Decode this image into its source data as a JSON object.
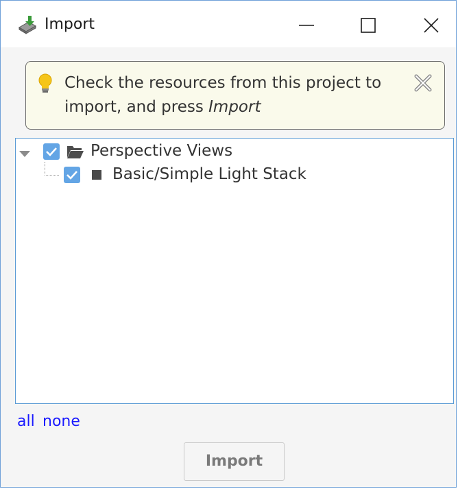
{
  "window": {
    "title": "Import",
    "icon": "import-icon",
    "controls": [
      "minimize-icon",
      "maximize-icon",
      "close-icon"
    ]
  },
  "banner": {
    "icon": "lightbulb-icon",
    "text_before": "Check the resources from this project to import, and press ",
    "text_emphasis": "Import",
    "dismiss_icon": "dismiss-icon"
  },
  "tree": {
    "root": {
      "label": "Perspective Views",
      "checked": true,
      "expanded": true,
      "icon": "folder-open-icon",
      "children": [
        {
          "label": "Basic/Simple Light Stack",
          "checked": true,
          "icon": "view-icon"
        }
      ]
    }
  },
  "links": {
    "all": "all",
    "none": "none"
  },
  "actions": {
    "import_label": "Import"
  },
  "colors": {
    "accent": "#63a5e5",
    "banner_bg": "#fafaeb",
    "link": "#1a1aff",
    "tree_border": "#5b9bd5"
  }
}
